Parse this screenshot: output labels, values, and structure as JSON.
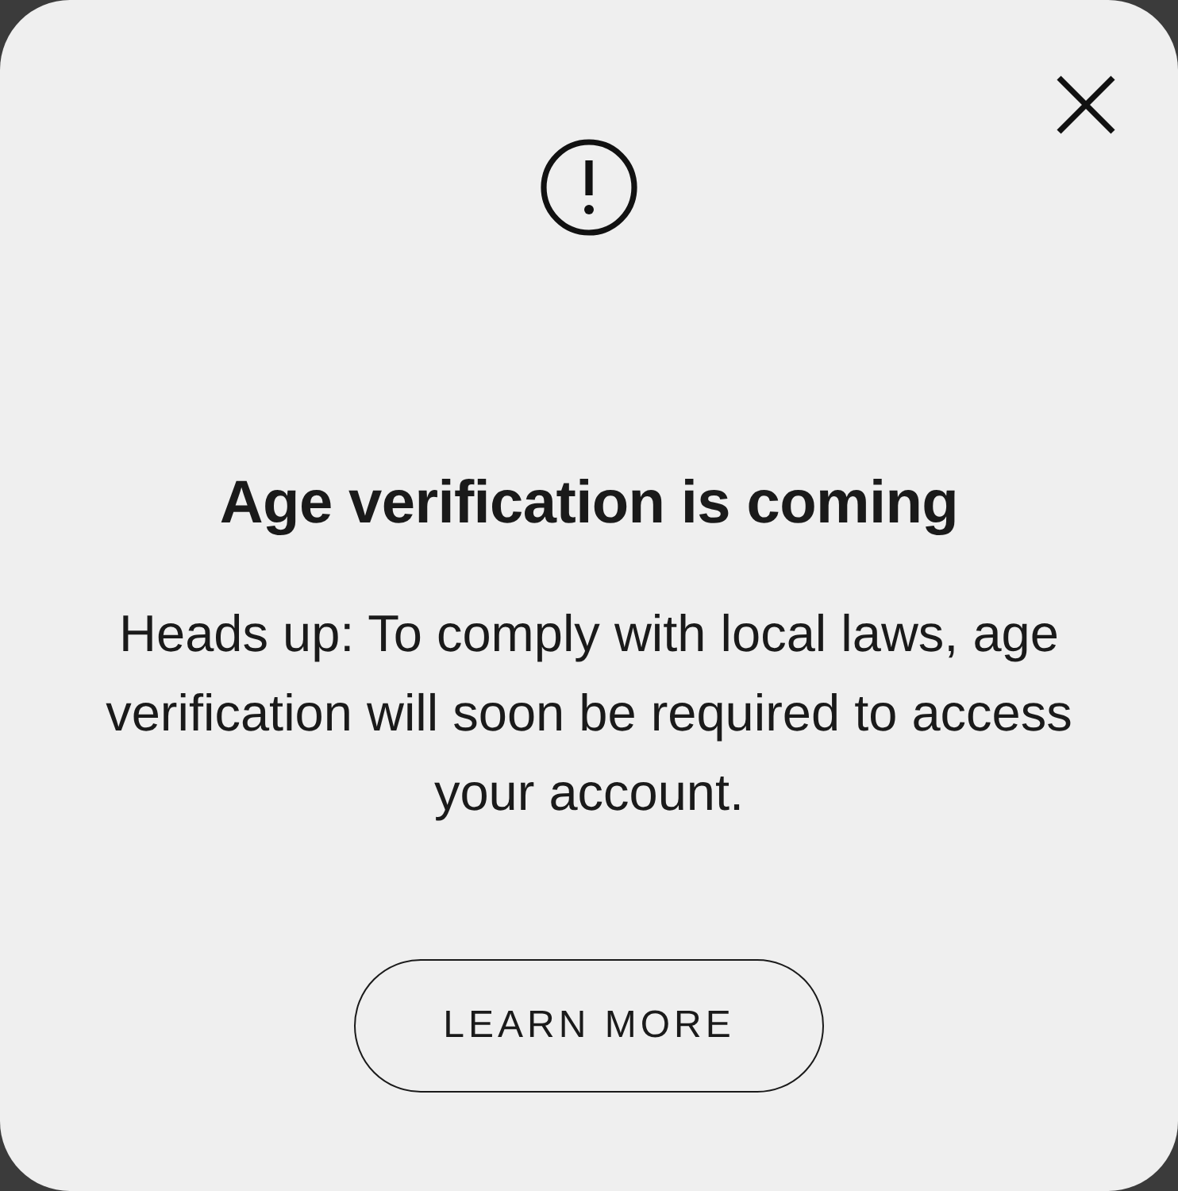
{
  "dialog": {
    "title": "Age verification is coming",
    "message": "Heads up: To comply with local laws, age verification will soon be required to access your account.",
    "button": "LEARN MORE"
  }
}
